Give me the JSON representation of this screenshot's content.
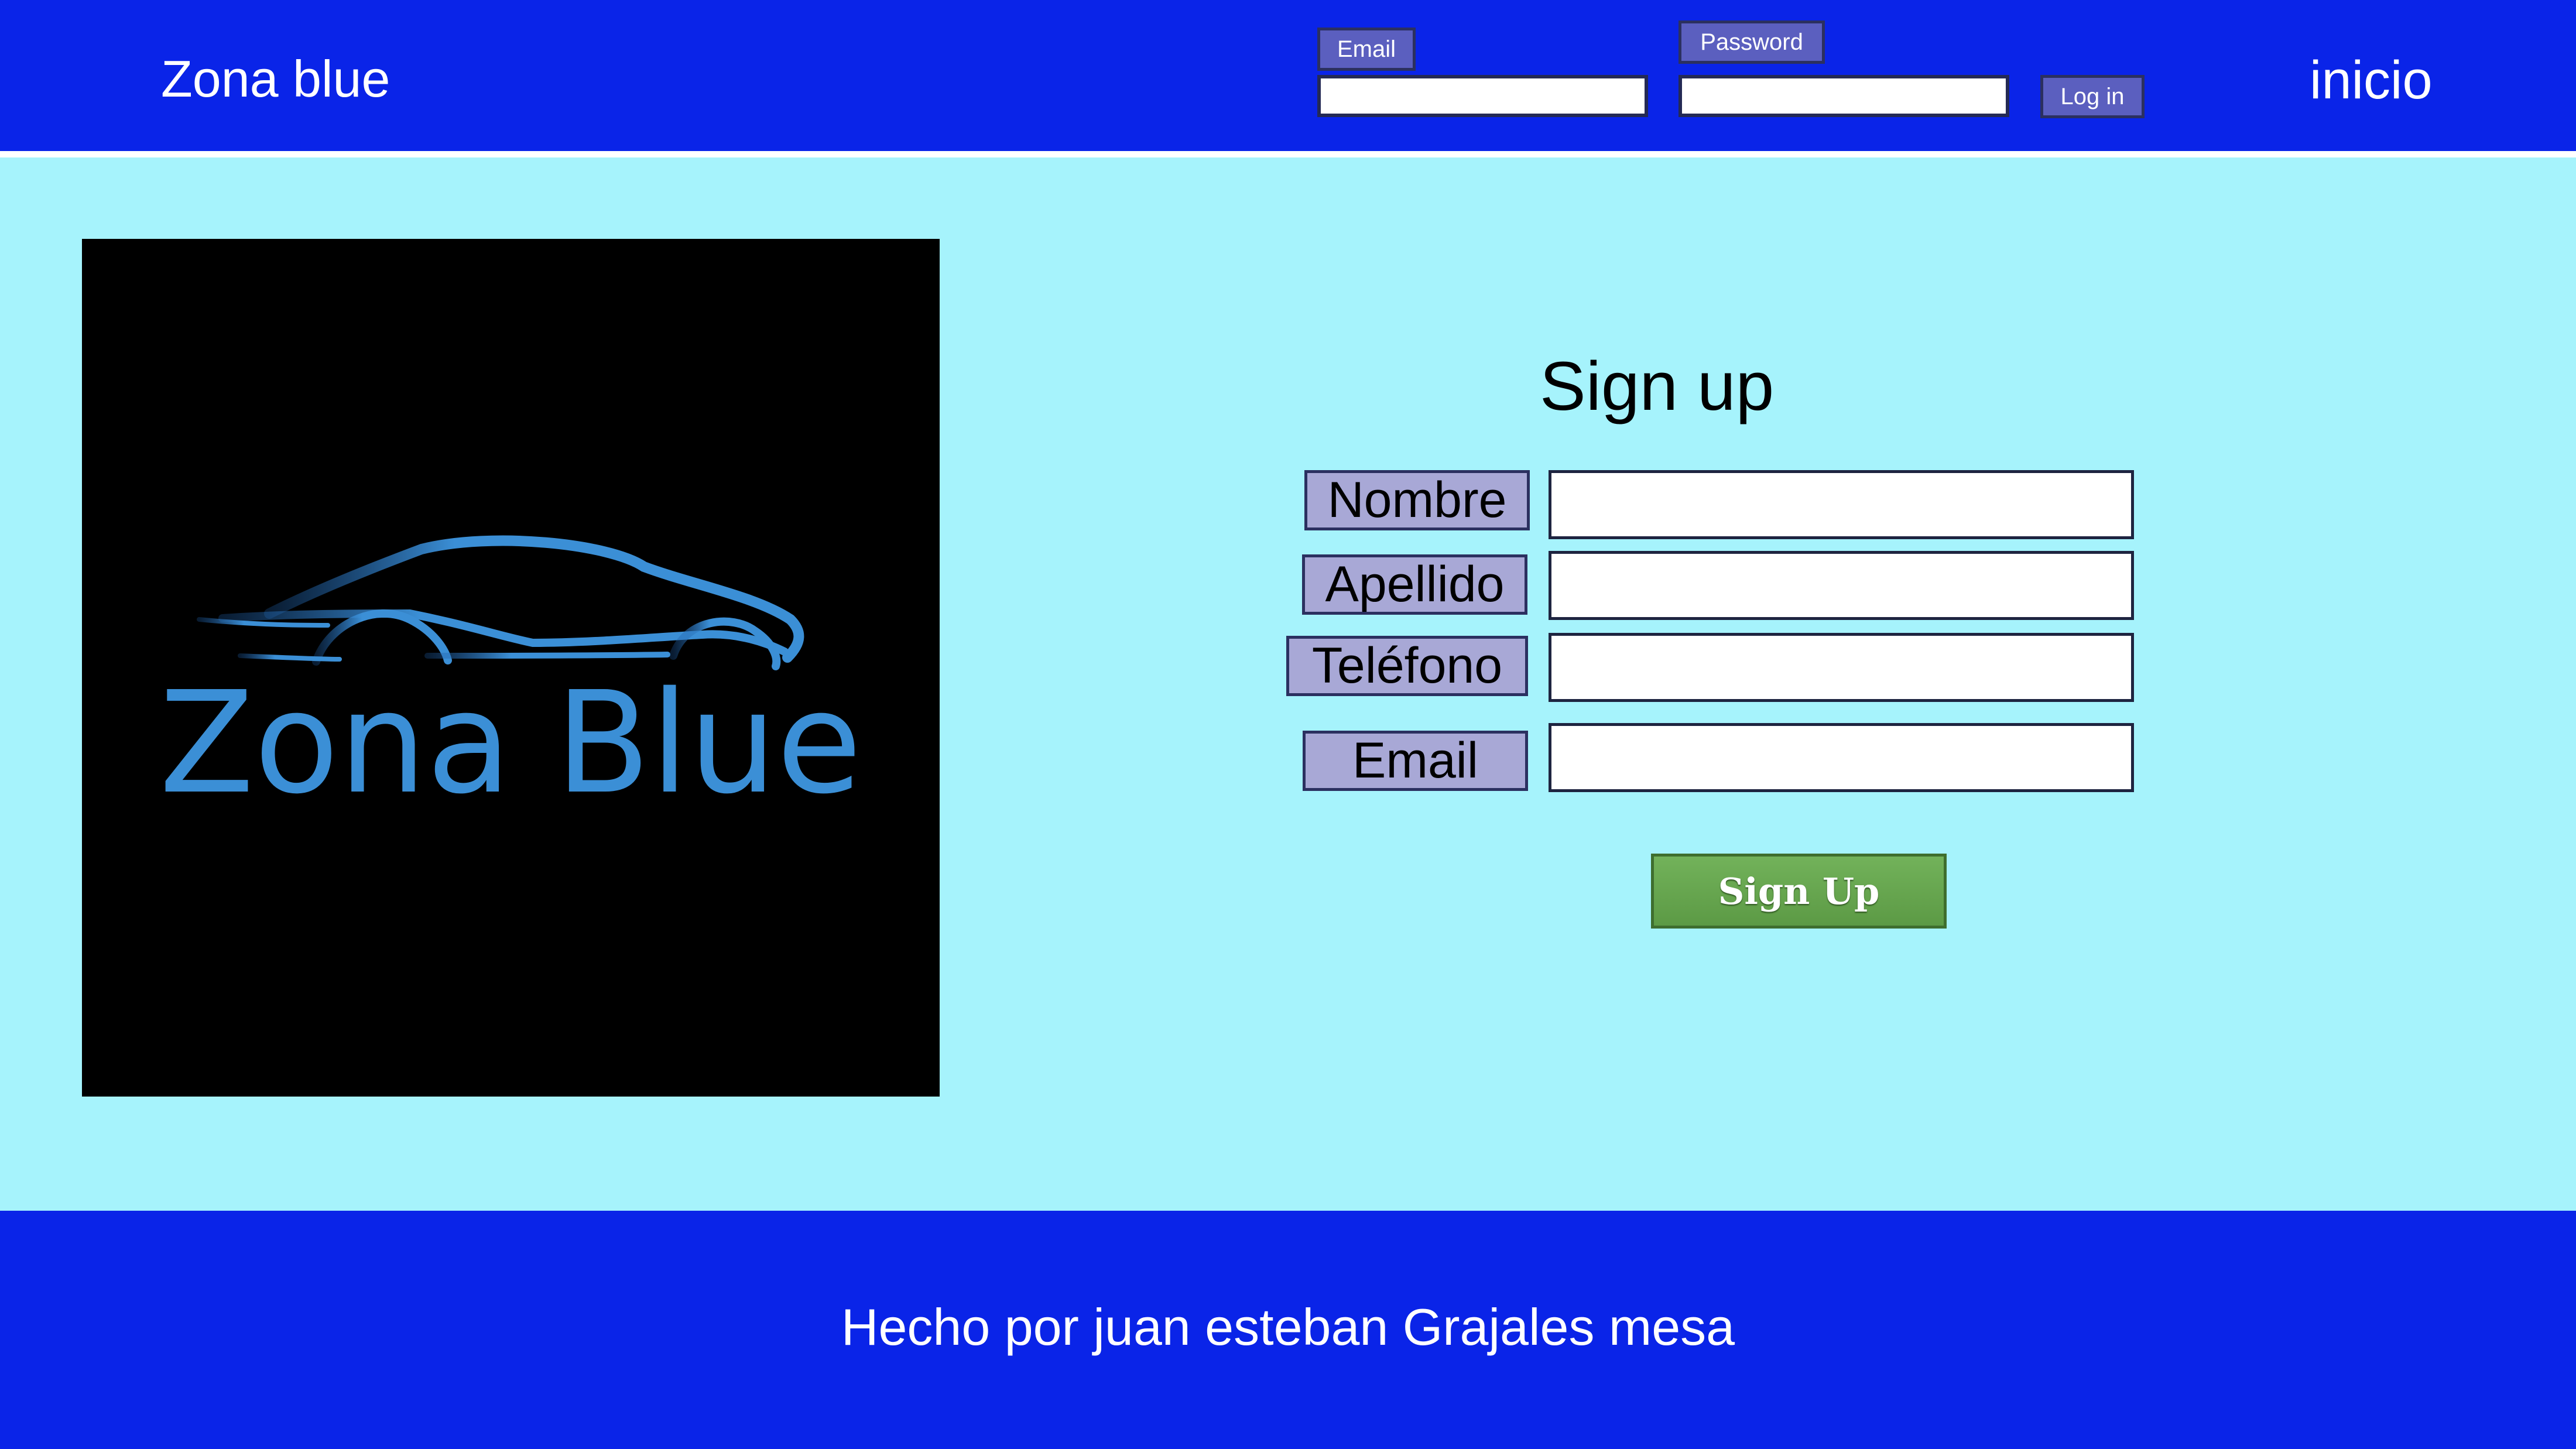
{
  "header": {
    "brand": "Zona blue",
    "email_label": "Email",
    "password_label": "Password",
    "email_value": "",
    "password_value": "",
    "login_label": "Log in",
    "nav_link": "inicio"
  },
  "logo": {
    "text": "Zona Blue",
    "color": "#3b8fd6"
  },
  "form": {
    "title": "Sign up",
    "fields": [
      {
        "label": "Nombre",
        "value": ""
      },
      {
        "label": "Apellido",
        "value": ""
      },
      {
        "label": "Teléfono",
        "value": ""
      },
      {
        "label": "Email",
        "value": ""
      }
    ],
    "submit_label": "Sign Up"
  },
  "footer": {
    "text": "Hecho por juan esteban Grajales mesa"
  },
  "colors": {
    "header_bg": "#0a24e8",
    "page_bg": "#a6f3fc",
    "label_bg": "#5b5fbf",
    "form_label_bg": "#a8a8d6",
    "button_green": "#66a64e"
  }
}
